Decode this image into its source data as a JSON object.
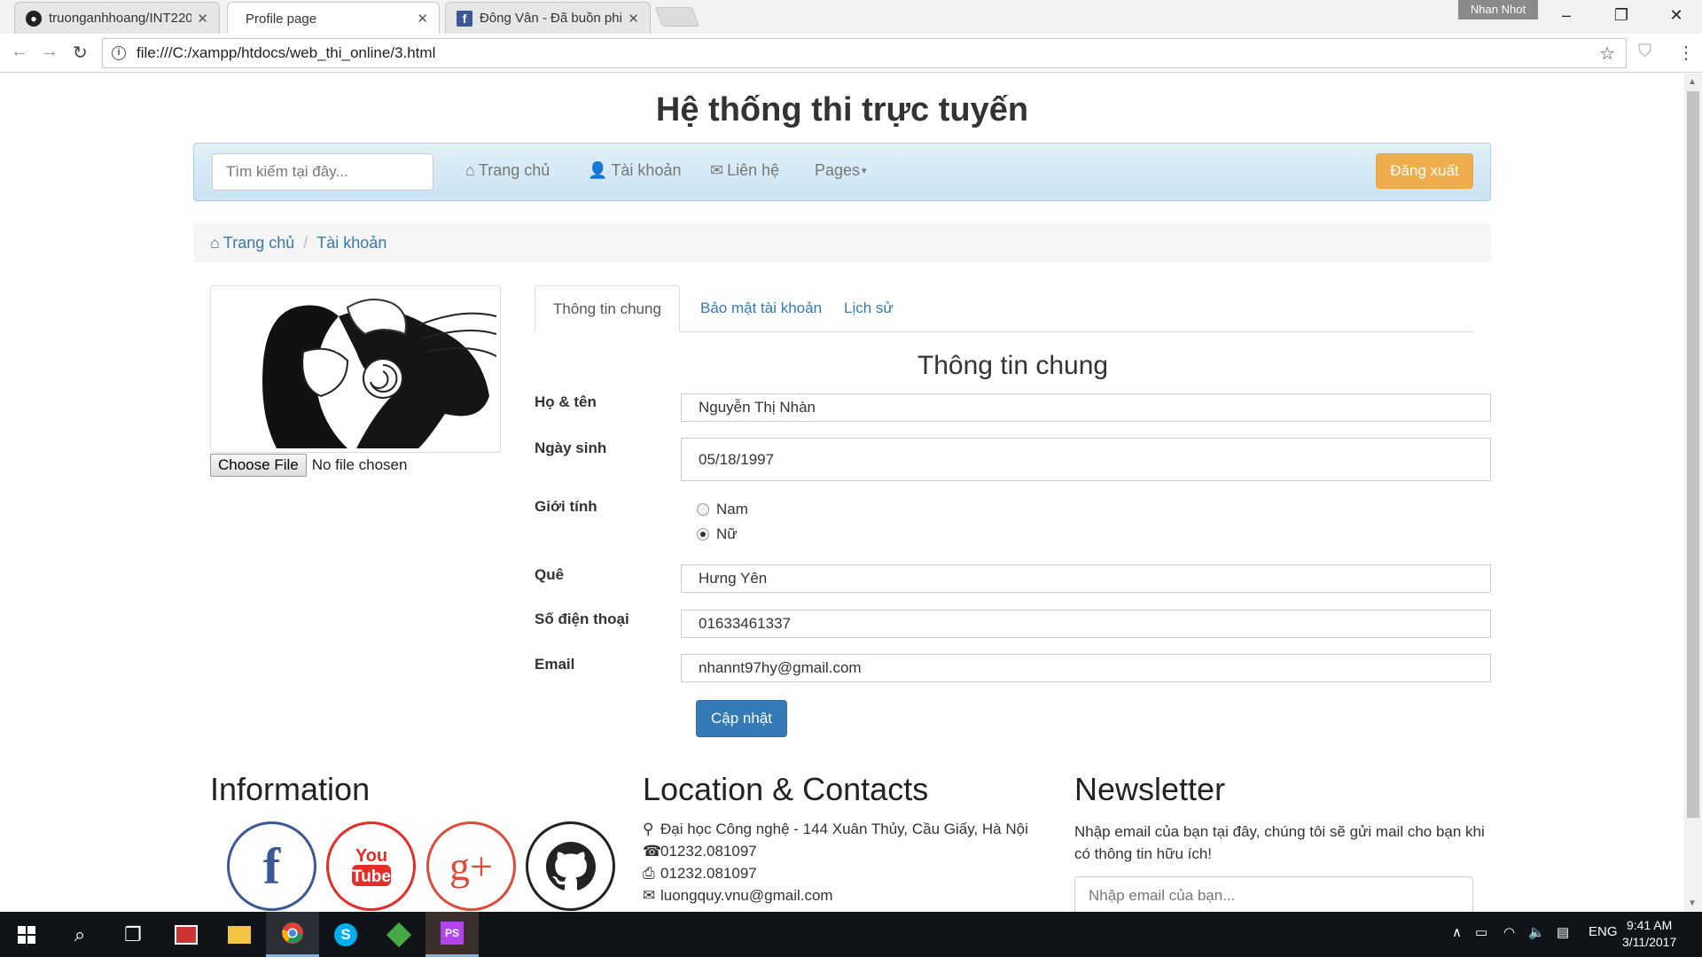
{
  "browser": {
    "tabs": [
      {
        "title": "truonganhhoang/INT220",
        "favicon": "github-icon",
        "active": false
      },
      {
        "title": "Profile page",
        "favicon": "page-icon",
        "active": true
      },
      {
        "title": "Đông Vân - Đã buồn phi",
        "favicon": "facebook-icon",
        "active": false
      }
    ],
    "profile_name": "Nhan Nhot",
    "url": "file:///C:/xampp/htdocs/web_thi_online/3.html"
  },
  "site": {
    "title": "Hệ thống thi trực tuyến",
    "search_placeholder": "Tìm kiếm tại đây...",
    "nav": {
      "home": "Trang chủ",
      "account": "Tài khoản",
      "contact": "Liên hệ",
      "pages": "Pages",
      "logout": "Đăng xuất"
    },
    "breadcrumb": {
      "home": "Trang chủ",
      "current": "Tài khoản"
    }
  },
  "profile": {
    "file_button": "Choose File",
    "file_status": "No file chosen",
    "tabs": [
      "Thông tin chung",
      "Bảo mật tài khoản",
      "Lịch sử"
    ],
    "section_title": "Thông tin chung",
    "labels": {
      "name": "Họ & tên",
      "dob": "Ngày sinh",
      "gender": "Giới tính",
      "hometown": "Quê",
      "phone": "Số điện thoại",
      "email": "Email"
    },
    "values": {
      "name": "Nguyễn Thị Nhàn",
      "dob": "05/18/1997",
      "hometown": "Hưng Yên",
      "phone": "01633461337",
      "email": "nhannt97hy@gmail.com"
    },
    "gender_options": {
      "male": "Nam",
      "female": "Nữ",
      "selected": "female"
    },
    "update_button": "Cập nhật"
  },
  "footer": {
    "info_title": "Information",
    "location_title": "Location & Contacts",
    "address": "Đại học Công nghệ - 144 Xuân Thủy, Cầu Giấy, Hà Nội",
    "phone": "01232.081097",
    "fax": "01232.081097",
    "email": "luongquy.vnu@gmail.com",
    "newsletter_title": "Newsletter",
    "newsletter_text": "Nhập email của bạn tại đây, chúng tôi sẽ gửi mail cho bạn khi có thông tin hữu ích!",
    "newsletter_placeholder": "Nhập email của bạn...",
    "social": [
      {
        "name": "facebook-icon",
        "glyph": "f",
        "color": "#3b5998"
      },
      {
        "name": "youtube-icon",
        "glyph": "You Tube",
        "color": "#e52d27"
      },
      {
        "name": "google-plus-icon",
        "glyph": "g+",
        "color": "#dd4b39"
      },
      {
        "name": "github-icon",
        "glyph": "",
        "color": "#222222"
      }
    ]
  },
  "taskbar": {
    "language": "ENG",
    "time": "9:41 AM",
    "date": "3/11/2017"
  },
  "colors": {
    "primary": "#337ab7",
    "warning": "#f0ad4e",
    "navbar": "#d9edf7"
  }
}
